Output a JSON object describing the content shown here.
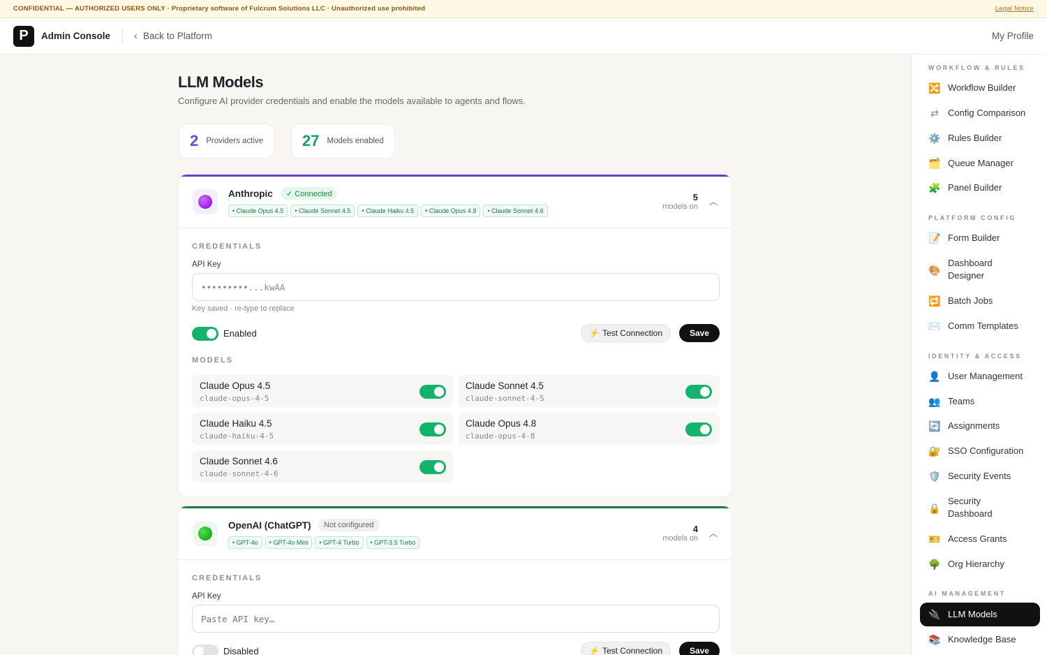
{
  "banner": {
    "text": "CONFIDENTIAL — AUTHORIZED USERS ONLY · Proprietary software of Fulcrum Solutions LLC · Unauthorized use prohibited",
    "legal_link": "Legal Notice"
  },
  "topbar": {
    "logo_letter": "P",
    "app_name": "Admin Console",
    "back_label": "Back to Platform",
    "profile_label": "My Profile"
  },
  "page": {
    "title": "LLM Models",
    "subtitle": "Configure AI provider credentials and enable the models available to agents and flows."
  },
  "stats": [
    {
      "value": "2",
      "label": "Providers active",
      "color": "#5b4fe0"
    },
    {
      "value": "27",
      "label": "Models enabled",
      "color": "#13a35e"
    }
  ],
  "providers": [
    {
      "name": "Anthropic",
      "status": "✓ Connected",
      "accent": "#6b3fd4",
      "dot_color": "#a012e6",
      "chips": [
        "• Claude Opus 4.5",
        "• Claude Sonnet 4.5",
        "• Claude Haiku 4.5",
        "• Claude Opus 4.8",
        "• Claude Sonnet 4.6"
      ],
      "count": "5",
      "count_label": "models on",
      "credentials_label": "CREDENTIALS",
      "api_key_label": "API Key",
      "api_key_value": "•••••••••...kwAA",
      "api_key_hint": "Key saved · re-type to replace",
      "enabled_label": "Enabled",
      "enabled": true,
      "test_label": "Test Connection",
      "save_label": "Save",
      "models_label": "MODELS",
      "models": [
        {
          "name": "Claude Opus 4.5",
          "id": "claude-opus-4-5",
          "on": true
        },
        {
          "name": "Claude Sonnet 4.5",
          "id": "claude-sonnet-4-5",
          "on": true
        },
        {
          "name": "Claude Haiku 4.5",
          "id": "claude-haiku-4-5",
          "on": true
        },
        {
          "name": "Claude Opus 4.8",
          "id": "claude-opus-4-8",
          "on": true
        },
        {
          "name": "Claude Sonnet 4.6",
          "id": "claude-sonnet-4-6",
          "on": true
        }
      ]
    },
    {
      "name": "OpenAI (ChatGPT)",
      "status": "Not configured",
      "accent": "#1f7a3a",
      "dot_color": "#0ea30e",
      "chips": [
        "• GPT-4o",
        "• GPT-4o Mini",
        "• GPT-4 Turbo",
        "• GPT-3.5 Turbo"
      ],
      "count": "4",
      "count_label": "models on",
      "credentials_label": "CREDENTIALS",
      "api_key_label": "API Key",
      "api_key_placeholder": "Paste API key…",
      "enabled_label": "Disabled",
      "enabled": false,
      "test_label": "Test Connection",
      "save_label": "Save"
    }
  ],
  "sidebar": {
    "groups": [
      {
        "label": "WORKFLOW & RULES",
        "items": [
          {
            "label": "Workflow Builder",
            "icon": "🔀"
          },
          {
            "label": "Config Comparison",
            "icon": "⇄"
          },
          {
            "label": "Rules Builder",
            "icon": "⚙️"
          },
          {
            "label": "Queue Manager",
            "icon": "🗂️"
          },
          {
            "label": "Panel Builder",
            "icon": "🧩"
          }
        ]
      },
      {
        "label": "PLATFORM CONFIG",
        "items": [
          {
            "label": "Form Builder",
            "icon": "📝"
          },
          {
            "label": "Dashboard Designer",
            "icon": "🎨"
          },
          {
            "label": "Batch Jobs",
            "icon": "🔁"
          },
          {
            "label": "Comm Templates",
            "icon": "✉️"
          }
        ]
      },
      {
        "label": "IDENTITY & ACCESS",
        "items": [
          {
            "label": "User Management",
            "icon": "👤"
          },
          {
            "label": "Teams",
            "icon": "👥"
          },
          {
            "label": "Assignments",
            "icon": "🔄"
          },
          {
            "label": "SSO Configuration",
            "icon": "🔐"
          },
          {
            "label": "Security Events",
            "icon": "🛡️"
          },
          {
            "label": "Security Dashboard",
            "icon": "🔒"
          },
          {
            "label": "Access Grants",
            "icon": "🎫"
          },
          {
            "label": "Org Hierarchy",
            "icon": "🌳"
          }
        ]
      },
      {
        "label": "AI MANAGEMENT",
        "items": [
          {
            "label": "LLM Models",
            "icon": "🔌",
            "active": true
          },
          {
            "label": "Knowledge Base",
            "icon": "📚"
          }
        ]
      }
    ]
  }
}
